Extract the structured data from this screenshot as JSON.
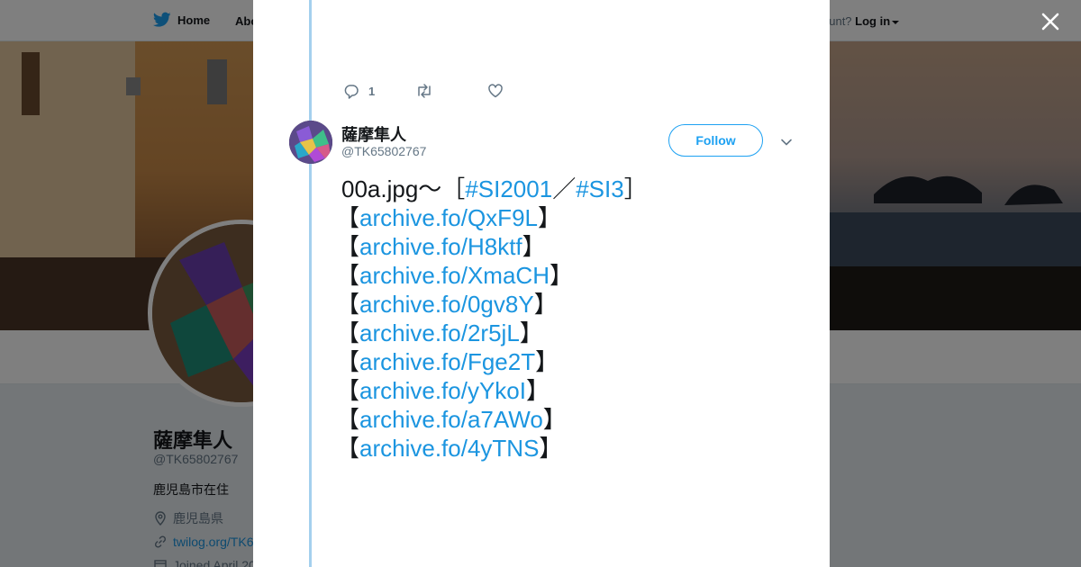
{
  "nav": {
    "home": "Home",
    "about": "Abo",
    "account_prompt": "ccount?",
    "login": "Log in"
  },
  "profile": {
    "name": "薩摩隼人",
    "handle": "@TK65802767",
    "bio": "鹿児島市在住",
    "location": "鹿児島県",
    "link": "twilog.org/TK6",
    "joined": "Joined April 20"
  },
  "tweet": {
    "reply_count": "1",
    "author_name": "薩摩隼人",
    "author_handle": "@TK65802767",
    "follow_label": "Follow",
    "line1_prefix": "00a.jpg～［",
    "hashtag1": "#SI2001",
    "slash": "／",
    "hashtag2": "#SI3",
    "line1_suffix": "］",
    "links": [
      "archive.fo/QxF9L",
      "archive.fo/H8ktf",
      "archive.fo/XmaCH",
      "archive.fo/0gv8Y",
      "archive.fo/2r5jL",
      "archive.fo/Fge2T",
      "archive.fo/yYkoI",
      "archive.fo/a7AWo",
      "archive.fo/4yTNS"
    ],
    "bracket_open": "【",
    "bracket_close": "】"
  },
  "icons": {
    "bird": "twitter-bird-icon",
    "close": "close-icon",
    "reply": "reply-icon",
    "retweet": "retweet-icon",
    "like": "heart-icon",
    "more": "chevron-down-icon",
    "location": "location-pin-icon",
    "link": "link-icon",
    "calendar": "calendar-icon"
  },
  "colors": {
    "brand": "#1da1f2",
    "link": "#1b95e0",
    "thread": "#a4d0ee"
  }
}
